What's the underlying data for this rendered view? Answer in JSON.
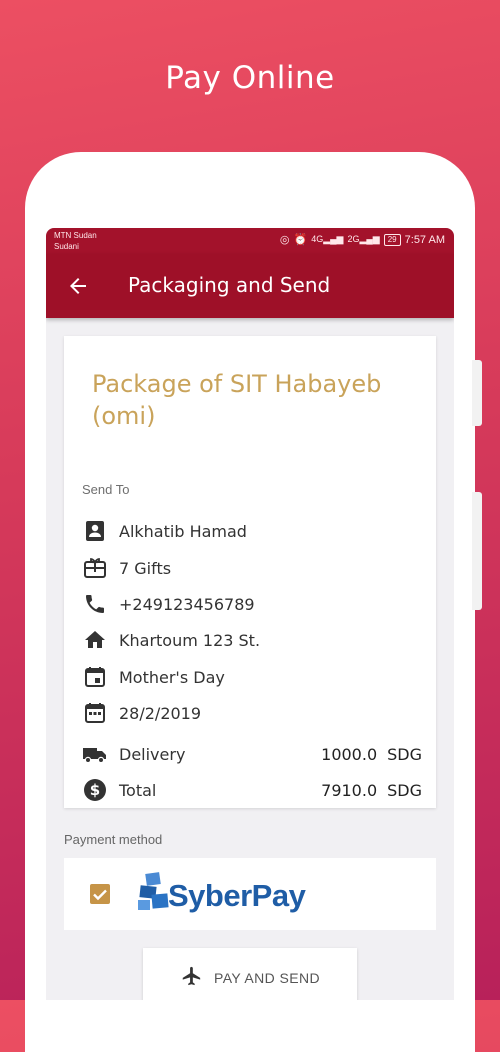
{
  "hero": {
    "title": "Pay Online"
  },
  "status_bar": {
    "carrier_line1": "MTN Sudan",
    "carrier_line2": "Sudani",
    "network1": "4G",
    "network2": "2G",
    "battery": "29",
    "time": "7:57 AM"
  },
  "app_bar": {
    "title": "Packaging and Send",
    "back_icon": "arrow-back-icon"
  },
  "package": {
    "title": "Package of SIT Habayeb (omi)",
    "send_to_label": "Send To",
    "recipient": "Alkhatib Hamad",
    "gifts": "7 Gifts",
    "phone": "+249123456789",
    "address": "Khartoum 123 St.",
    "occasion": "Mother's Day",
    "date": "28/2/2019",
    "delivery_label": "Delivery",
    "delivery_amount": "1000.0",
    "delivery_currency": "SDG",
    "total_label": "Total",
    "total_amount": "7910.0",
    "total_currency": "SDG"
  },
  "payment": {
    "label": "Payment method",
    "provider": "SyberPay",
    "selected": true
  },
  "action": {
    "label": "PAY AND SEND",
    "icon": "airplane-icon"
  },
  "colors": {
    "accent_red": "#a3122b",
    "gold": "#c9a35a",
    "syberpay_blue": "#1f5da6"
  }
}
